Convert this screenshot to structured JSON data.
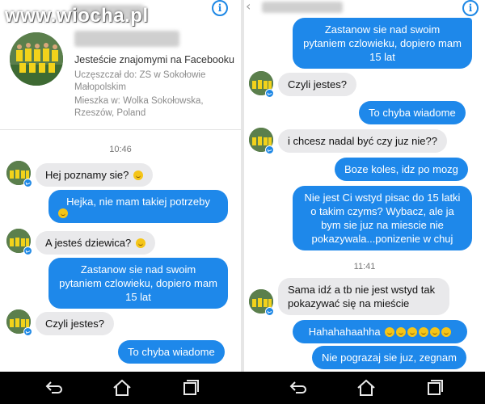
{
  "watermark": "www.wiocha.pl",
  "left": {
    "info_icon": "info-icon",
    "profile": {
      "friends_line": "Jesteście znajomymi na Facebooku",
      "school_line": "Uczęszczał do: ZS w Sokołowie Małopolskim",
      "home_line": "Mieszka w: Wolka Sokołowska, Rzeszów, Poland"
    },
    "time": "10:46",
    "messages": [
      {
        "side": "in",
        "text": "Hej poznamy sie?",
        "emoji": true
      },
      {
        "side": "out",
        "text": "Hejka, nie mam takiej potrzeby",
        "emoji": true
      },
      {
        "side": "in",
        "text": "A jesteś dziewica?",
        "emoji": true
      },
      {
        "side": "out",
        "text": "Zastanow sie nad swoim pytaniem czlowieku, dopiero mam 15 lat",
        "emoji": false
      },
      {
        "side": "in",
        "text": "Czyli jestes?",
        "emoji": false
      },
      {
        "side": "out",
        "text": "To chyba wiadome",
        "emoji": false
      }
    ]
  },
  "right": {
    "info_icon": "info-icon",
    "back_icon": "chevron-left-icon",
    "time": "11:41",
    "messages": [
      {
        "side": "out",
        "text": "Zastanow sie nad swoim pytaniem czlowieku, dopiero mam 15 lat"
      },
      {
        "side": "in",
        "text": "Czyli jestes?"
      },
      {
        "side": "out",
        "text": "To chyba wiadome"
      },
      {
        "side": "in",
        "text": "i chcesz nadal być czy juz nie??"
      },
      {
        "side": "out",
        "text": "Boze koles, idz po mozg"
      },
      {
        "side": "out",
        "text": "Nie jest Ci wstyd pisac do 15 latki o takim czyms? Wybacz, ale ja bym sie juz na miescie nie pokazywala...ponizenie w chuj"
      },
      {
        "side": "in",
        "text": "Sama idź a tb nie jest wstyd tak pokazywać się na mieście"
      },
      {
        "side": "out",
        "text": "Hahahahaahha",
        "emoji_count": 6
      },
      {
        "side": "out",
        "text": "Nie pograzaj sie juz, zegnam"
      }
    ]
  },
  "navbar": {
    "back_icon": "back-icon",
    "home_icon": "home-icon",
    "recents_icon": "recents-icon"
  },
  "colors": {
    "outgoing_bubble": "#1e88ea",
    "incoming_bubble": "#e9e9eb",
    "accent": "#1e88e5",
    "navbar": "#000000"
  }
}
